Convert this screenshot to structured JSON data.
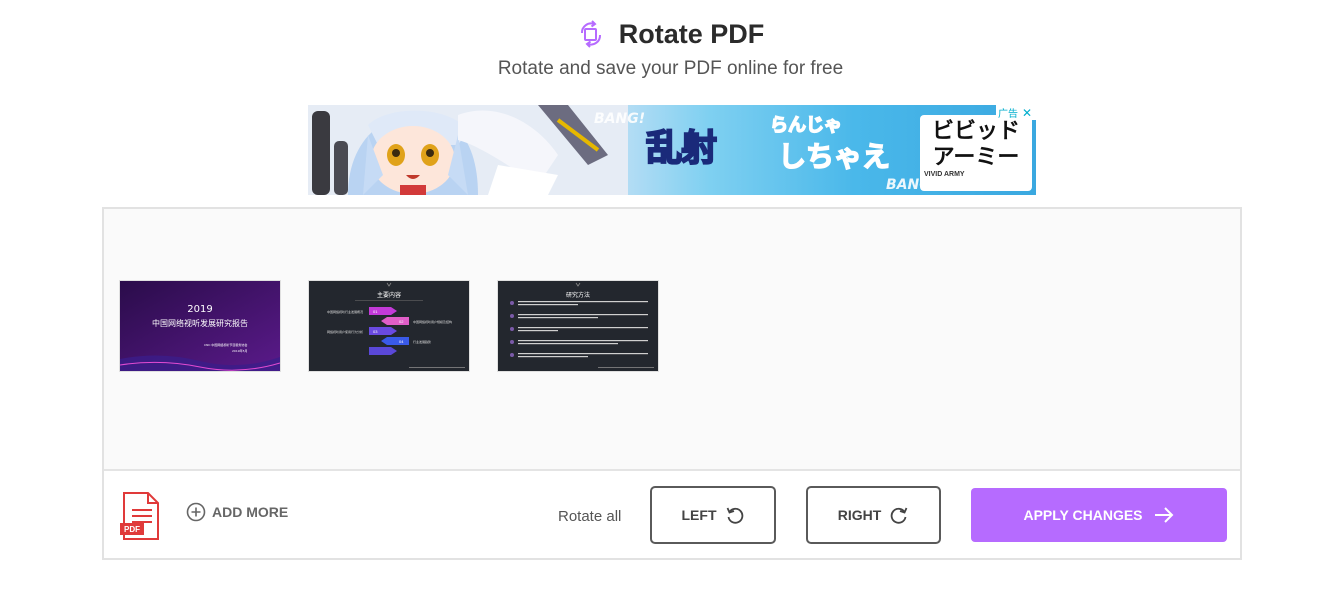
{
  "header": {
    "title": "Rotate PDF",
    "subtitle": "Rotate and save your PDF online for free",
    "icon": "rotate-icon",
    "accent_color": "#b66bff"
  },
  "ad": {
    "badge_label": "广告",
    "bang_text": "BANG!",
    "headline": "乱射",
    "headline_kana": "らんじゃ",
    "tagline": "しちゃえ",
    "brand": "ビビッドアーミー",
    "brand_sub": "VIVID ARMY"
  },
  "pages": [
    {
      "title_line1": "2019",
      "title_line2": "中国网络视听发展研究报告",
      "footer_text": "CNC 中国网络视听节目服务协会",
      "footer_sub": "2019年5月"
    },
    {
      "heading": "主要内容",
      "items": [
        {
          "num": "01",
          "text": "中国网络视听行业发展概况"
        },
        {
          "num": "02",
          "text": "中国网络视听用户规模及结构"
        },
        {
          "num": "03",
          "text": "网络视听用户使用行为分析"
        },
        {
          "num": "04",
          "text": "行业发展趋势"
        }
      ]
    },
    {
      "heading": "研究方法",
      "rows": 5
    }
  ],
  "toolbar": {
    "add_more_label": "ADD MORE",
    "rotate_all_label": "Rotate all",
    "left_label": "LEFT",
    "right_label": "RIGHT",
    "apply_label": "APPLY CHANGES",
    "file_icon_text": "PDF"
  }
}
